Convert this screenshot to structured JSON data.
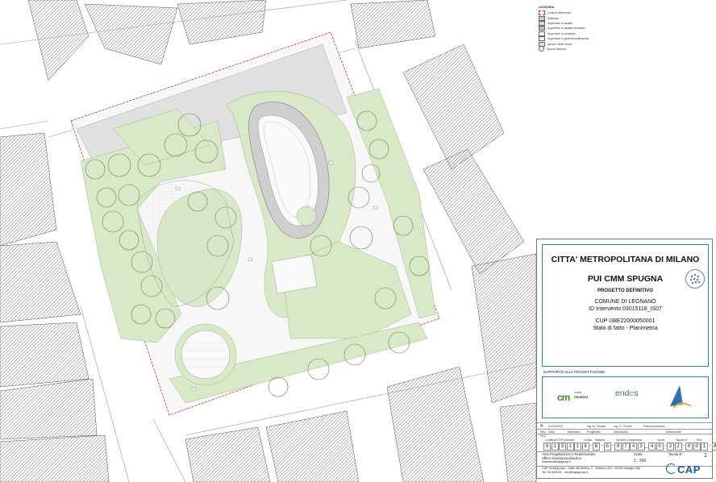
{
  "legend": {
    "title": "LEGENDA",
    "items": [
      "Limiti di intervento",
      "Edificato",
      "Superficie in asfalto",
      "Superficie in asfalto drenante",
      "Superficie in cemento",
      "Superficie in gomma antitrauma",
      "Aiuola / Area verde",
      "Specie arboree"
    ]
  },
  "titleblock": {
    "authority": "CITTA' METROPOLITANA DI MILANO",
    "program": "PUI CMM SPUGNA",
    "phase": "PROGETTO DEFINITIVO",
    "municipality": "COMUNE DI LEGNANO",
    "intervention_id": "ID Intervento 03015118_IS07",
    "cup": "CUP I38E22000050001",
    "drawing": "Stato di fatto - Planimetria",
    "support_label": "SUPPORTO ALLA PROGETTAZIONE",
    "logo1_mark": "cm",
    "logo1_small": "studio",
    "logo1_name": "nicolosi",
    "logo2": "end",
    "logo2_o": "e",
    "logo2_end": "s",
    "rev_letter": "A",
    "rev_date": "01/10/2022",
    "rev_by": "ing. M. Ceriani",
    "rev_check": "ing. G. Crivelli",
    "rev_desc": "Prima emissione",
    "rev_headers": [
      "Rev.",
      "Data",
      "Elaborato",
      "Progettato",
      "Autorizzato",
      "Descrizione"
    ],
    "file_label": "FILE",
    "code_headers": [
      "Codifica ETIP Comune",
      "Livello",
      "Materia",
      "Numero Commessa",
      "Area",
      "Tavola N°",
      "Rev."
    ],
    "code_cells": [
      "0",
      "1",
      "5",
      "1",
      "1",
      "8",
      "-",
      "B",
      "-",
      "G",
      "-",
      "9",
      "7",
      "4",
      "3",
      "_",
      "4",
      "0",
      "-",
      "2",
      "2",
      "-",
      "0",
      "0",
      "1",
      "-",
      "A"
    ],
    "dept": "Area Progettazione e Realizzazione",
    "office": "Ufficio Invarianza idraulica",
    "email": "invarianza@capgroup.it",
    "company": "CAP Holding spa - Viale del Mulino, 2 - Edificio U10 - 20090 Assago (MI)",
    "contacts": "Tel. 02.825021 - info@capgroup.it",
    "scale_label": "Scala",
    "scale": "1 : 200",
    "sheet_label": "Tavola N°",
    "sheet": "1",
    "cap_logo": "CAP"
  }
}
